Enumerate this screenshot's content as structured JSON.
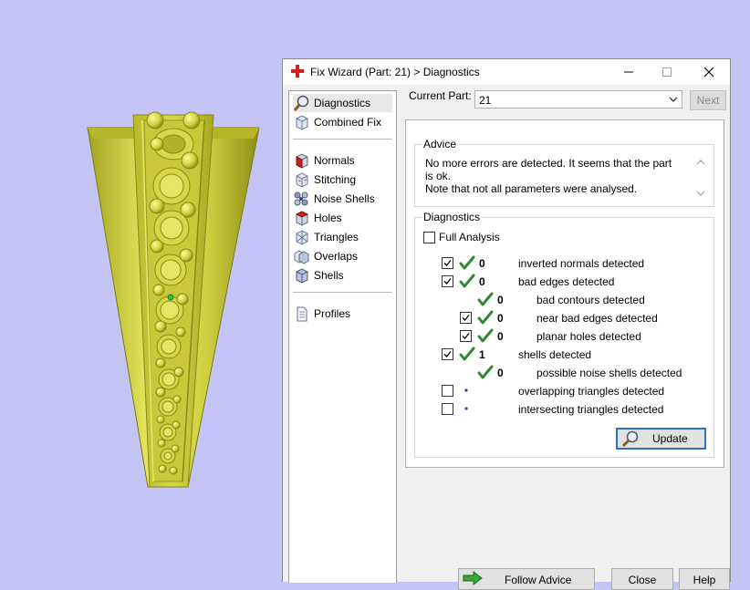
{
  "dialog": {
    "title": "Fix Wizard (Part: 21) > Diagnostics",
    "current_part_label": "Current Part:",
    "current_part_value": "21",
    "next_label": "Next"
  },
  "sidebar": {
    "items": [
      {
        "label": "Diagnostics",
        "icon": "magnifier-icon",
        "selected": true
      },
      {
        "label": "Combined Fix",
        "icon": "cube-icon"
      },
      {
        "label": "Normals",
        "icon": "normals-cube-icon"
      },
      {
        "label": "Stitching",
        "icon": "stitching-cube-icon"
      },
      {
        "label": "Noise Shells",
        "icon": "noise-shells-icon"
      },
      {
        "label": "Holes",
        "icon": "holes-cube-icon"
      },
      {
        "label": "Triangles",
        "icon": "triangles-icon"
      },
      {
        "label": "Overlaps",
        "icon": "overlaps-icon"
      },
      {
        "label": "Shells",
        "icon": "shells-icon"
      },
      {
        "label": "Profiles",
        "icon": "document-icon"
      }
    ]
  },
  "advice": {
    "title": "Advice",
    "text_line1": "No more errors are detected. It seems that the part is ok.",
    "text_line2": "Note that not all parameters were analysed."
  },
  "diagnostics": {
    "title": "Diagnostics",
    "full_analysis_label": "Full Analysis",
    "rows": [
      {
        "checkbox": true,
        "checked": true,
        "status": "ok",
        "count": "0",
        "label": "inverted normals detected"
      },
      {
        "checkbox": true,
        "checked": true,
        "status": "ok",
        "count": "0",
        "label": "bad edges detected"
      },
      {
        "checkbox": false,
        "status": "ok",
        "count": "0",
        "label": "bad contours detected"
      },
      {
        "checkbox": true,
        "checked": true,
        "status": "ok",
        "count": "0",
        "label": "near bad edges detected"
      },
      {
        "checkbox": true,
        "checked": true,
        "status": "ok",
        "count": "0",
        "label": "planar holes detected"
      },
      {
        "checkbox": true,
        "checked": true,
        "status": "ok",
        "count": "1",
        "label": "shells detected"
      },
      {
        "checkbox": false,
        "status": "ok",
        "count": "0",
        "label": "possible noise shells detected"
      },
      {
        "checkbox": true,
        "checked": false,
        "status": "pending",
        "count": "",
        "label": "overlapping triangles detected"
      },
      {
        "checkbox": true,
        "checked": false,
        "status": "pending",
        "count": "",
        "label": "intersecting triangles detected"
      }
    ],
    "update_label": "Update"
  },
  "buttons": {
    "follow_advice": "Follow Advice",
    "close": "Close",
    "help": "Help"
  },
  "colors": {
    "background": "#c4c4f6",
    "model": "#d8d84a",
    "check_green": "#2f8a2f",
    "pending_dot": "#2040c0"
  }
}
